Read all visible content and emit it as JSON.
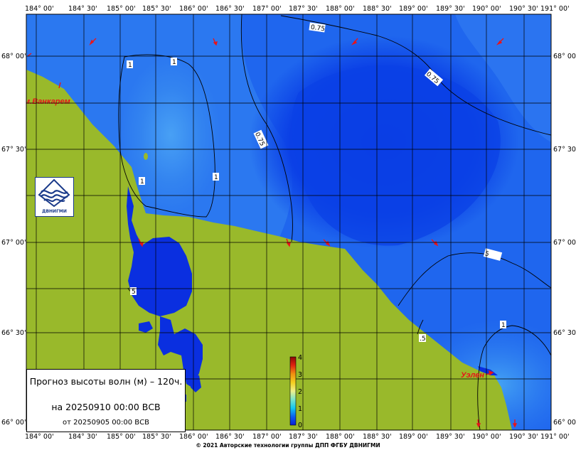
{
  "map": {
    "lon_labels": [
      "184° 00'",
      "184° 30'",
      "185° 00'",
      "185° 30'",
      "186° 00'",
      "186° 30'",
      "187° 00'",
      "187° 30'",
      "188° 00'",
      "188° 30'",
      "189° 00'",
      "189° 30'",
      "190° 00'",
      "190° 30'",
      "191° 00'"
    ],
    "lat_labels": [
      "68° 00'",
      "67° 30'",
      "67° 00'",
      "66° 30'",
      "66° 00'"
    ],
    "places": [
      {
        "id": "vankarem",
        "label": "м.Ванкарем"
      },
      {
        "id": "uelen",
        "label": "Уэлен"
      }
    ],
    "isolines": [
      "0.75",
      "1",
      "1",
      "0.75",
      "1",
      "1",
      "0.75",
      "1",
      ".5",
      "5"
    ],
    "colorbar_ticks": [
      "4",
      "3",
      "2",
      "1",
      "0"
    ],
    "colors": {
      "land": "#99b92b",
      "sea_deep": "#0a3ee6",
      "sea_mid": "#1c66ee",
      "sea_light": "#3a8cf2",
      "place": "#e8141a"
    }
  },
  "legend": {
    "line1": "Прогноз высоты волн (м) – 120ч.",
    "line2": "на 20250910 00:00 ВСВ",
    "line3": "от 20250905 00:00 ВСВ"
  },
  "logo": {
    "text": "ДВНИГМИ"
  },
  "footer": {
    "copyright": "© 2021 Авторские технологии группы ДПП ФГБУ ДВНИГМИ"
  }
}
